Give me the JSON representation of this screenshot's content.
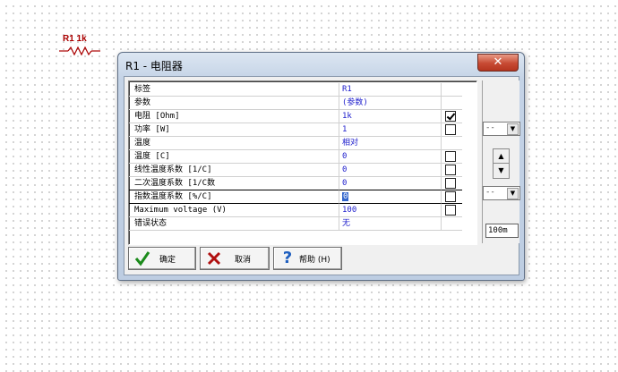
{
  "schematic": {
    "component_label": "R1 1k"
  },
  "dialog": {
    "title": "R1 - 电阻器",
    "close_icon": "close-icon",
    "properties": [
      {
        "name": "标签",
        "value": "R1",
        "has_checkbox": false,
        "checked": false
      },
      {
        "name": "参数",
        "value": "(参数)",
        "has_checkbox": false,
        "checked": false
      },
      {
        "name": "电阻 [Ohm]",
        "value": "1k",
        "has_checkbox": true,
        "checked": true
      },
      {
        "name": "功率        [W]",
        "value": "1",
        "has_checkbox": true,
        "checked": false
      },
      {
        "name": "温度",
        "value": "相对",
        "has_checkbox": false,
        "checked": false
      },
      {
        "name": "温度 [C]",
        "value": "0",
        "has_checkbox": true,
        "checked": false
      },
      {
        "name": "线性温度系数 [1/C]",
        "value": "0",
        "has_checkbox": true,
        "checked": false
      },
      {
        "name": "二次温度系数 [1/C数",
        "value": "0",
        "has_checkbox": true,
        "checked": false
      },
      {
        "name": "指数温度系数 [%/C]",
        "value": "0",
        "has_checkbox": true,
        "checked": false,
        "selected": true
      },
      {
        "name": "Maximum voltage (V)",
        "value": "100",
        "has_checkbox": true,
        "checked": false
      },
      {
        "name": "错误状态",
        "value": "无",
        "has_checkbox": false,
        "checked": false
      }
    ],
    "sidebar": {
      "combo_top_value": "--",
      "combo_bottom_value": "--",
      "spin_up": "▲",
      "spin_down": "▼",
      "step_value": "100m"
    },
    "buttons": {
      "ok_label": "确定",
      "cancel_label": "取消",
      "help_label": "帮助 (H)"
    },
    "colors": {
      "value_text": "#1c1ccc",
      "close_button": "#c74a33",
      "ok_icon": "#1a8a1a",
      "cancel_icon": "#b01010",
      "help_icon": "#1f5fbf"
    }
  }
}
